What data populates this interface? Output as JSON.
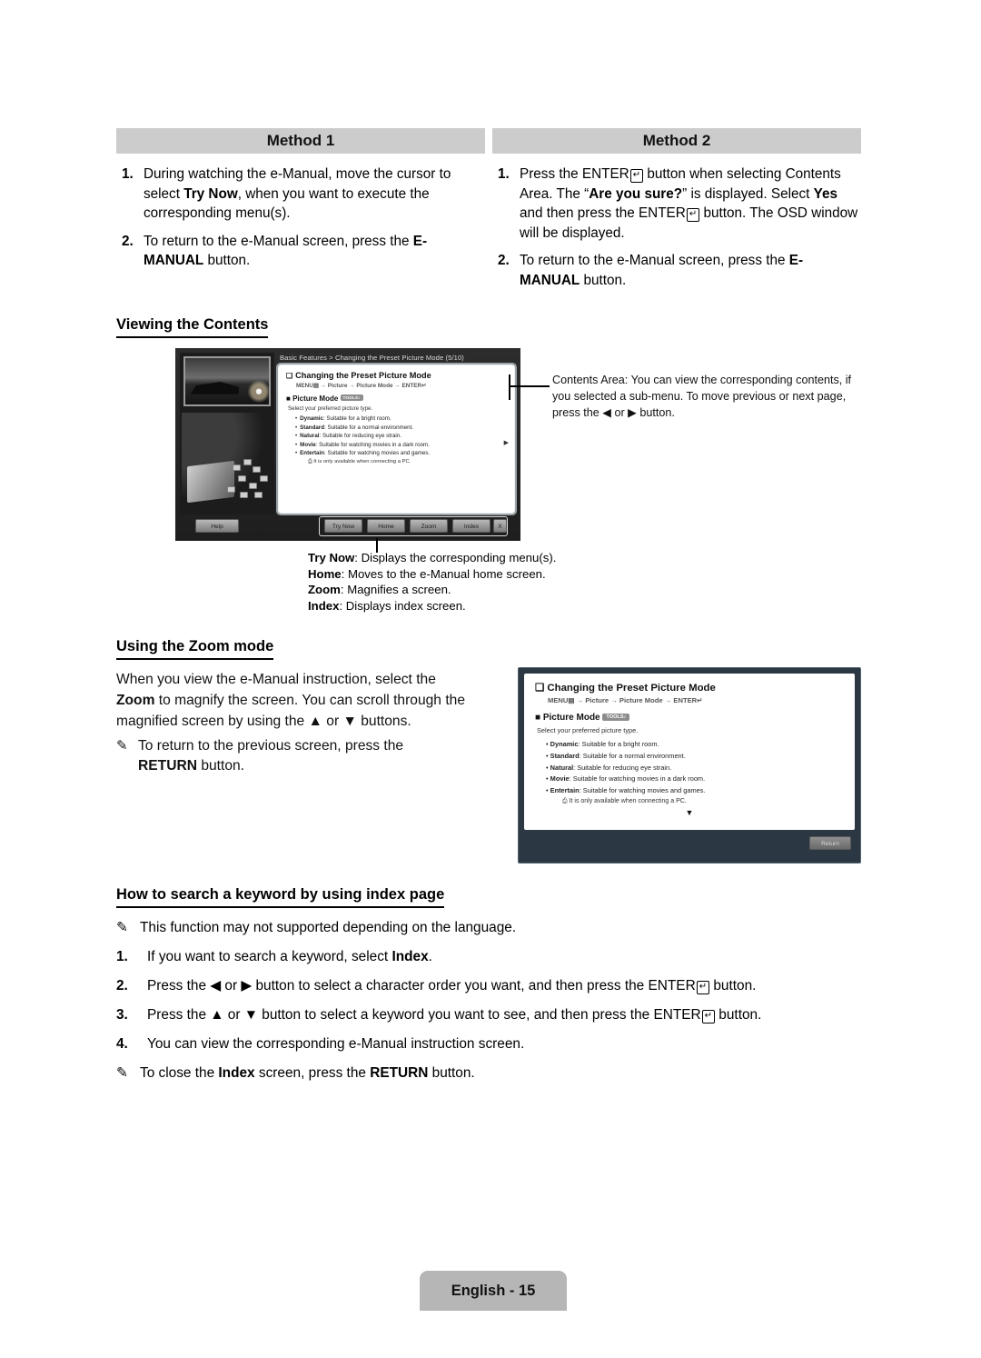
{
  "methods": [
    {
      "title": "Method 1",
      "steps": [
        {
          "num": "1.",
          "html": "During watching the e-Manual, move the cursor to select <b>Try Now</b>, when you want to execute the corresponding menu(s)."
        },
        {
          "num": "2.",
          "html": "To return to the e-Manual screen, press the <b>E-MANUAL</b> button."
        }
      ]
    },
    {
      "title": "Method 2",
      "steps": [
        {
          "num": "1.",
          "html": "Press the ENTER<span class=\"ent-icon\">&#8629;</span> button when selecting Contents Area. The &#8220;<b>Are you sure?</b>&#8221; is displayed. Select <b>Yes</b> and then press the ENTER<span class=\"ent-icon\">&#8629;</span> button. The OSD window will be displayed."
        },
        {
          "num": "2.",
          "html": "To return to the e-Manual screen, press the <b>E-MANUAL</b> button."
        }
      ]
    }
  ],
  "sections": {
    "viewing_contents": "Viewing the Contents",
    "zoom_mode": "Using the Zoom mode",
    "index_page": "How to search a keyword by using index page"
  },
  "tv_screen": {
    "breadcrumb": "Basic Features > Changing the Preset Picture Mode (5/10)",
    "content_title": "Changing the Preset Picture Mode",
    "content_path": "MENU▤ → Picture → Picture Mode → ENTER↵",
    "sub_title": "Picture Mode",
    "tools_badge": "TOOLS♪",
    "note": "Select your preferred picture type.",
    "items": [
      {
        "term": "Dynamic",
        "desc": ": Suitable for a bright room."
      },
      {
        "term": "Standard",
        "desc": ": Suitable for a normal environment."
      },
      {
        "term": "Natural",
        "desc": ": Suitable for reducing eye strain."
      },
      {
        "term": "Movie",
        "desc": ": Suitable for watching movies in a dark room."
      },
      {
        "term": "Entertain",
        "desc": ": Suitable for watching movies and games."
      }
    ],
    "pc_note": "It is only available when connecting a PC.",
    "help_button": "Help",
    "buttons": [
      "Try Now",
      "Home",
      "Zoom",
      "Index",
      "X"
    ]
  },
  "callout": {
    "contents_area": "Contents Area: You can view the corresponding contents, if you selected a sub-menu. To move previous or next page, press the ◀ or ▶ button."
  },
  "key_list": [
    {
      "term": "Try Now",
      "desc": ": Displays the corresponding menu(s)."
    },
    {
      "term": "Home",
      "desc": ": Moves to the e-Manual home screen."
    },
    {
      "term": "Zoom",
      "desc": ": Magnifies a screen."
    },
    {
      "term": "Index",
      "desc": ": Displays index screen."
    }
  ],
  "zoom_mode": {
    "paragraph_html": "When you view the e-Manual instruction, select the <b>Zoom</b> to magnify the screen. You can scroll through the magnified screen by using the ▲ or ▼ buttons.",
    "note_html": "To return to the previous screen, press the <br><b>RETURN</b> button."
  },
  "zoom_panel": {
    "title": "Changing the Preset Picture Mode",
    "path": "MENU▤ → Picture → Picture Mode → ENTER↵",
    "sub_title": "Picture Mode",
    "tools_badge": "TOOLS♪",
    "note": "Select your preferred picture type.",
    "items": [
      {
        "term": "Dynamic",
        "desc": ": Suitable for a bright room."
      },
      {
        "term": "Standard",
        "desc": ": Suitable for a normal environment."
      },
      {
        "term": "Natural",
        "desc": ": Suitable for reducing eye strain."
      },
      {
        "term": "Movie",
        "desc": ": Suitable for watching movies in a dark room."
      },
      {
        "term": "Entertain",
        "desc": ": Suitable for watching movies and games."
      }
    ],
    "pc_note": "It is only available when connecting a PC.",
    "scroll_down": "▼",
    "return_button": "Return"
  },
  "index_steps": {
    "note_top": "This function may not supported depending on the language.",
    "rows": [
      {
        "num": "1.",
        "html": "If you want to search a keyword, select <b>Index</b>."
      },
      {
        "num": "2.",
        "html": "Press the ◀ or ▶ button to select a character order you want, and then press the ENTER<span class=\"ent-icon\">&#8629;</span> button."
      },
      {
        "num": "3.",
        "html": "Press the ▲ or ▼ button to select a keyword you want to see, and then press the ENTER<span class=\"ent-icon\">&#8629;</span> button."
      },
      {
        "num": "4.",
        "html": "You can view the corresponding e-Manual instruction screen."
      }
    ],
    "note_bottom_html": "To close the <b>Index</b> screen, press the <b>RETURN</b> button."
  },
  "footer": {
    "page_label": "English - 15"
  },
  "colors": {
    "header_bar": "#cccccc",
    "footer_tab": "#b6b6b6",
    "tv_background": "#262626",
    "zoom_panel_border": "#55656f",
    "zoom_panel_bg": "#2b3843"
  }
}
